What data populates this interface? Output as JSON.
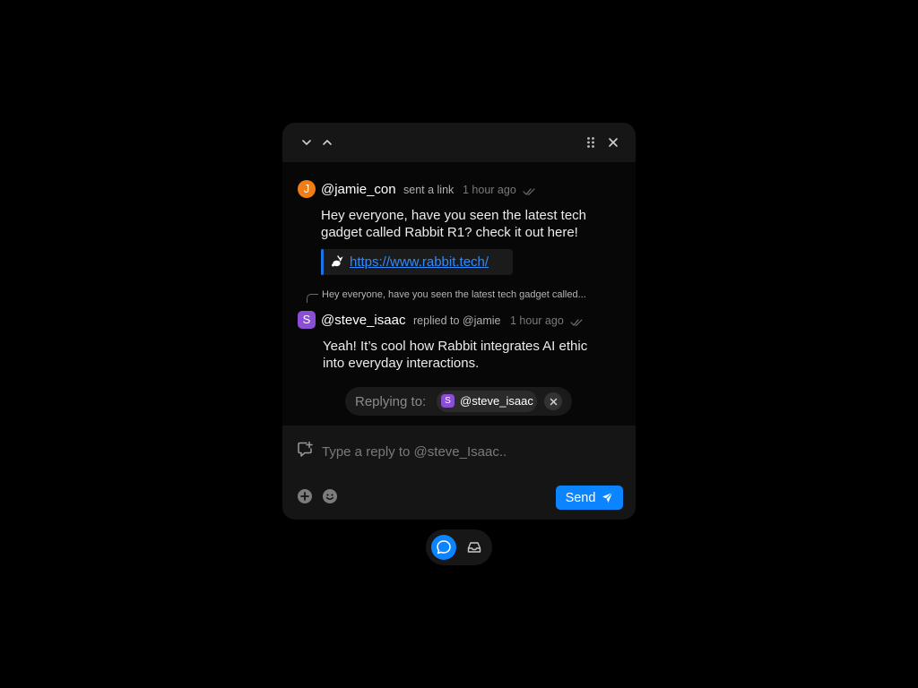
{
  "header": {
    "icons": [
      "chevron-down-icon",
      "chevron-up-icon",
      "drag-handle-icon",
      "close-icon"
    ]
  },
  "messages": [
    {
      "avatar_letter": "J",
      "avatar_color": "#f07d16",
      "username": "@jamie_con",
      "action": "sent a link",
      "time": "1 hour ago",
      "body_lines": [
        "Hey everyone, have you seen the latest tech",
        "gadget called Rabbit R1? check it out here!"
      ],
      "link": {
        "icon": "rabbit-icon",
        "url": "https://www.rabbit.tech/"
      }
    },
    {
      "quoted_text": "Hey everyone, have you seen the latest tech gadget called...",
      "avatar_letter": "S",
      "avatar_color": "#8b4fd6",
      "username": "@steve_isaac",
      "action": "replied to @jamie",
      "time": "1 hour ago",
      "body_lines": [
        "Yeah! It’s cool how Rabbit integrates AI ethic",
        "into everyday interactions."
      ]
    }
  ],
  "reply_target": {
    "label": "Replying to:",
    "avatar_letter": "S",
    "username": "@steve_isaac"
  },
  "composer": {
    "placeholder": "Type a reply to @steve_Isaac..",
    "value": "",
    "send_label": "Send",
    "icons": [
      "add-comment-icon",
      "add-icon",
      "emoji-icon",
      "send-icon"
    ]
  },
  "switcher": {
    "active": "chat",
    "icons": [
      "chat-bubble-icon",
      "inbox-icon"
    ]
  },
  "colors": {
    "accent": "#0a84ff",
    "link": "#2e8bff",
    "background": "#000000",
    "panel": "#070707"
  }
}
